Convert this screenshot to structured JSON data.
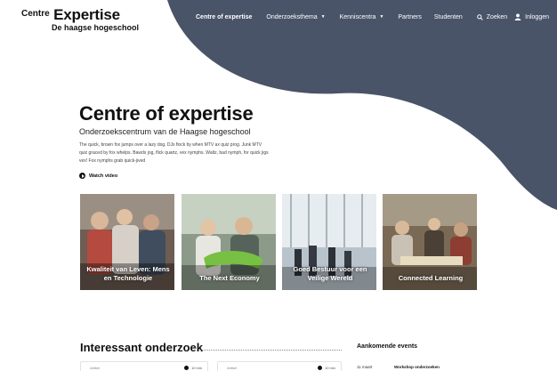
{
  "colors": {
    "accent": "#4a5468",
    "text": "#1d1d1f",
    "background": "#ffffff"
  },
  "logo": {
    "small": "Centre",
    "big": "Expertise",
    "sub": "De haagse hogeschool"
  },
  "nav": {
    "items": [
      {
        "label": "Centre of expertise",
        "active": true
      },
      {
        "label": "Onderzoeksthema",
        "dropdown": true
      },
      {
        "label": "Kenniscentra",
        "dropdown": true
      },
      {
        "label": "Partners"
      },
      {
        "label": "Studenten"
      }
    ],
    "search_label": "Zoeken",
    "login_label": "Inloggen",
    "search_icon": "search-icon",
    "user_icon": "user-icon"
  },
  "hero": {
    "title": "Centre of expertise",
    "subtitle": "Onderzoekscentrum van de Haagse hogeschool",
    "text": "The quick, brown fox jumps over a lazy dog. DJs flock by when MTV ax quiz prog. Junk MTV quiz graced by fox whelps. Bawds jog, flick quartz, vex nymphs. Waltz, bad nymph, for quick jigs vex! Fox nymphs grab quick-jived",
    "watch_video": "Watch video",
    "play_icon": "play-icon"
  },
  "cards": [
    {
      "label": "Kwaliteit van Leven: Mens en Technologie"
    },
    {
      "label": "The Next Economy"
    },
    {
      "label": "Goed Bestuur voor een Veilige Wereld"
    },
    {
      "label": "Connected Learning"
    }
  ],
  "research": {
    "title": "Interessant onderzoek",
    "items": [
      {
        "tag": "Artikel",
        "duration": "10 min"
      },
      {
        "tag": "Artikel",
        "duration": "10 min"
      }
    ]
  },
  "events": {
    "title": "Aankomende events",
    "items": [
      {
        "date": "11 maart",
        "name": "Workshop onderzoeken"
      }
    ]
  }
}
